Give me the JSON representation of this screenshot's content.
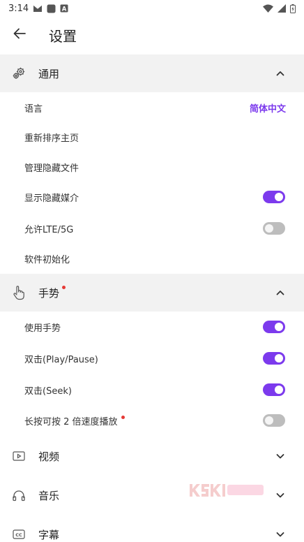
{
  "status_bar": {
    "time": "3:14",
    "left_icons": [
      "mail-icon",
      "app-icon",
      "a-icon"
    ],
    "right_icons": [
      "wifi-icon",
      "signal-icon",
      "battery-icon"
    ]
  },
  "app_bar": {
    "back_icon": "arrow-left-icon",
    "title": "设置"
  },
  "sections": {
    "general": {
      "icon": "gears-icon",
      "title": "通用",
      "expanded": true,
      "items": {
        "language": {
          "label": "语言",
          "value": "简体中文"
        },
        "reorder_home": {
          "label": "重新排序主页"
        },
        "manage_hidden": {
          "label": "管理隐藏文件"
        },
        "show_hidden_media": {
          "label": "显示隐藏媒介",
          "enabled": true
        },
        "allow_lte": {
          "label": "允许LTE/5G",
          "enabled": false
        },
        "reset_app": {
          "label": "软件初始化"
        }
      }
    },
    "gestures": {
      "icon": "hand-pointer-icon",
      "title": "手势",
      "has_badge": true,
      "expanded": true,
      "items": {
        "use_gestures": {
          "label": "使用手势",
          "enabled": true
        },
        "double_tap_play": {
          "label": "双击(Play/Pause)",
          "enabled": true
        },
        "double_tap_seek": {
          "label": "双击(Seek)",
          "enabled": true
        },
        "long_press_speed": {
          "label": "长按可按 2 倍速度播放",
          "enabled": false,
          "has_badge": true
        }
      }
    },
    "video": {
      "icon": "play-box-icon",
      "title": "视频",
      "expanded": false
    },
    "music": {
      "icon": "headphones-icon",
      "title": "音乐",
      "expanded": false
    },
    "subtitles": {
      "icon": "cc-icon",
      "title": "字幕",
      "expanded": false
    }
  },
  "colors": {
    "accent": "#7c3aed",
    "section_bg": "#f2f2f2",
    "toggle_off": "#bdbdbd",
    "badge": "#e53935"
  }
}
